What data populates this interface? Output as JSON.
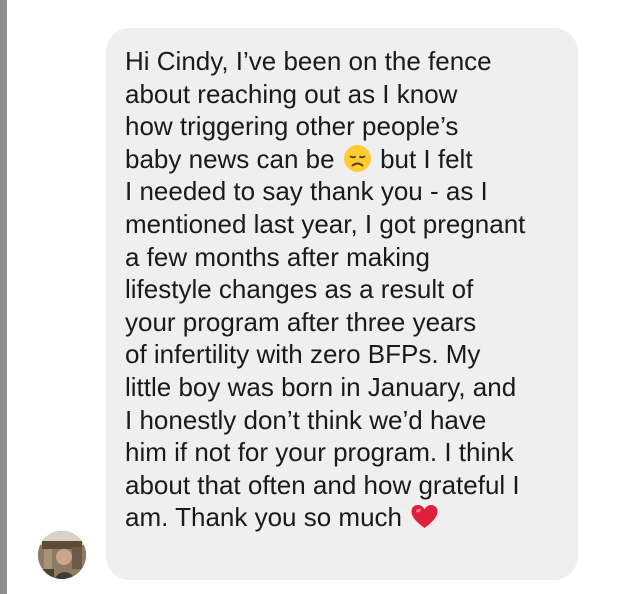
{
  "message": {
    "lines": [
      "Hi Cindy, I’ve been on the fence",
      "about reaching out as I know",
      "how triggering other people’s",
      "baby news can be",
      "but I felt",
      "I needed to say thank you - as I",
      "mentioned last year, I got pregnant",
      "a few months after making",
      "lifestyle changes as a result of",
      "your program after three years",
      "of infertility with zero BFPs. My",
      "little boy was born in January, and",
      "I honestly don’t think we’d have",
      "him if not for your program. I think",
      "about that often and how grateful I",
      "am. Thank you so much"
    ],
    "emojis": [
      "disappointed-face-icon",
      "red-heart-icon"
    ]
  },
  "colors": {
    "bubble": "#efefef",
    "text": "#1a1a1a",
    "left_edge": "#8e8e8e",
    "heart": "#e0203a",
    "face": "#ffcc33"
  }
}
